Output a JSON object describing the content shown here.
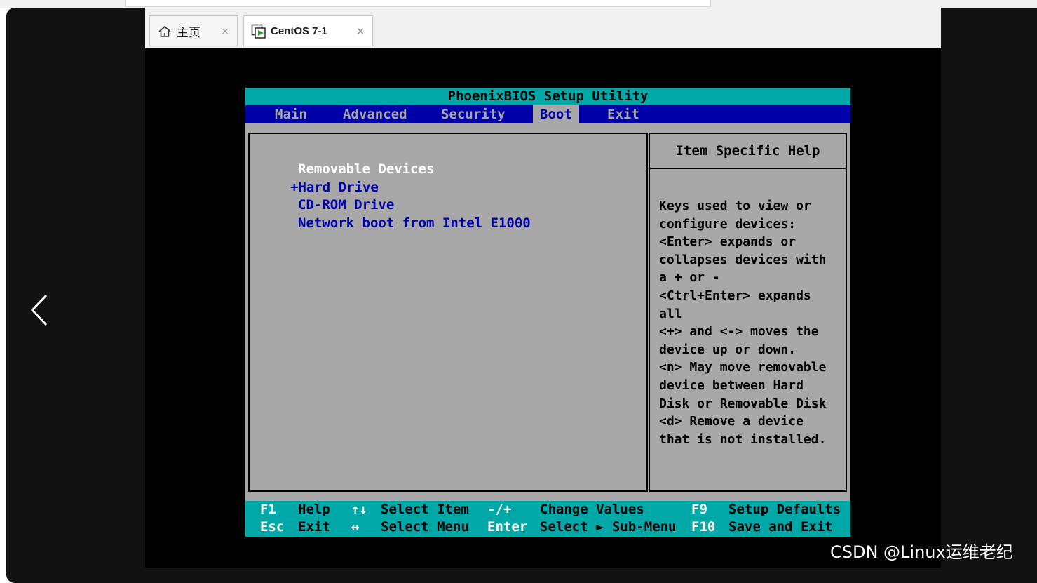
{
  "tabs": [
    {
      "label": "主页",
      "icon": "home-icon",
      "active": false
    },
    {
      "label": "CentOS 7-1",
      "icon": "vm-icon",
      "active": true
    }
  ],
  "close_glyph": "×",
  "bios": {
    "title": "PhoenixBIOS Setup Utility",
    "menu": [
      "Main",
      "Advanced",
      "Security",
      "Boot",
      "Exit"
    ],
    "active_menu": "Boot",
    "boot_order": [
      {
        "text": "Removable Devices",
        "color": "white"
      },
      {
        "text": "+Hard Drive",
        "color": "blue"
      },
      {
        "text": "CD-ROM Drive",
        "color": "blue"
      },
      {
        "text": "Network boot from Intel E1000",
        "color": "blue"
      }
    ],
    "help_title": "Item Specific Help",
    "help_text": "Keys used to view or\nconfigure devices:\n<Enter> expands or\ncollapses devices with\na + or -\n<Ctrl+Enter> expands\nall\n<+> and <-> moves the\ndevice up or down.\n<n> May move removable\ndevice between Hard\nDisk or Removable Disk\n<d> Remove a device\nthat is not installed.",
    "footer": [
      [
        {
          "key": "F1",
          "desc": "Help"
        },
        {
          "key": "↑↓",
          "desc": "Select Item"
        },
        {
          "key": "-/+",
          "desc": "Change Values"
        },
        {
          "key": "F9",
          "desc": "Setup Defaults"
        }
      ],
      [
        {
          "key": "Esc",
          "desc": "Exit"
        },
        {
          "key": "↔",
          "desc": "Select Menu"
        },
        {
          "key": "Enter",
          "desc": "Select ► Sub-Menu"
        },
        {
          "key": "F10",
          "desc": "Save and Exit"
        }
      ]
    ]
  },
  "watermark": "CSDN @Linux运维老纪",
  "colors": {
    "bios_cyan": "#00a8a8",
    "bios_blue": "#0000aa",
    "bios_gray": "#a8a8a8",
    "viewer_bg": "#121212"
  }
}
